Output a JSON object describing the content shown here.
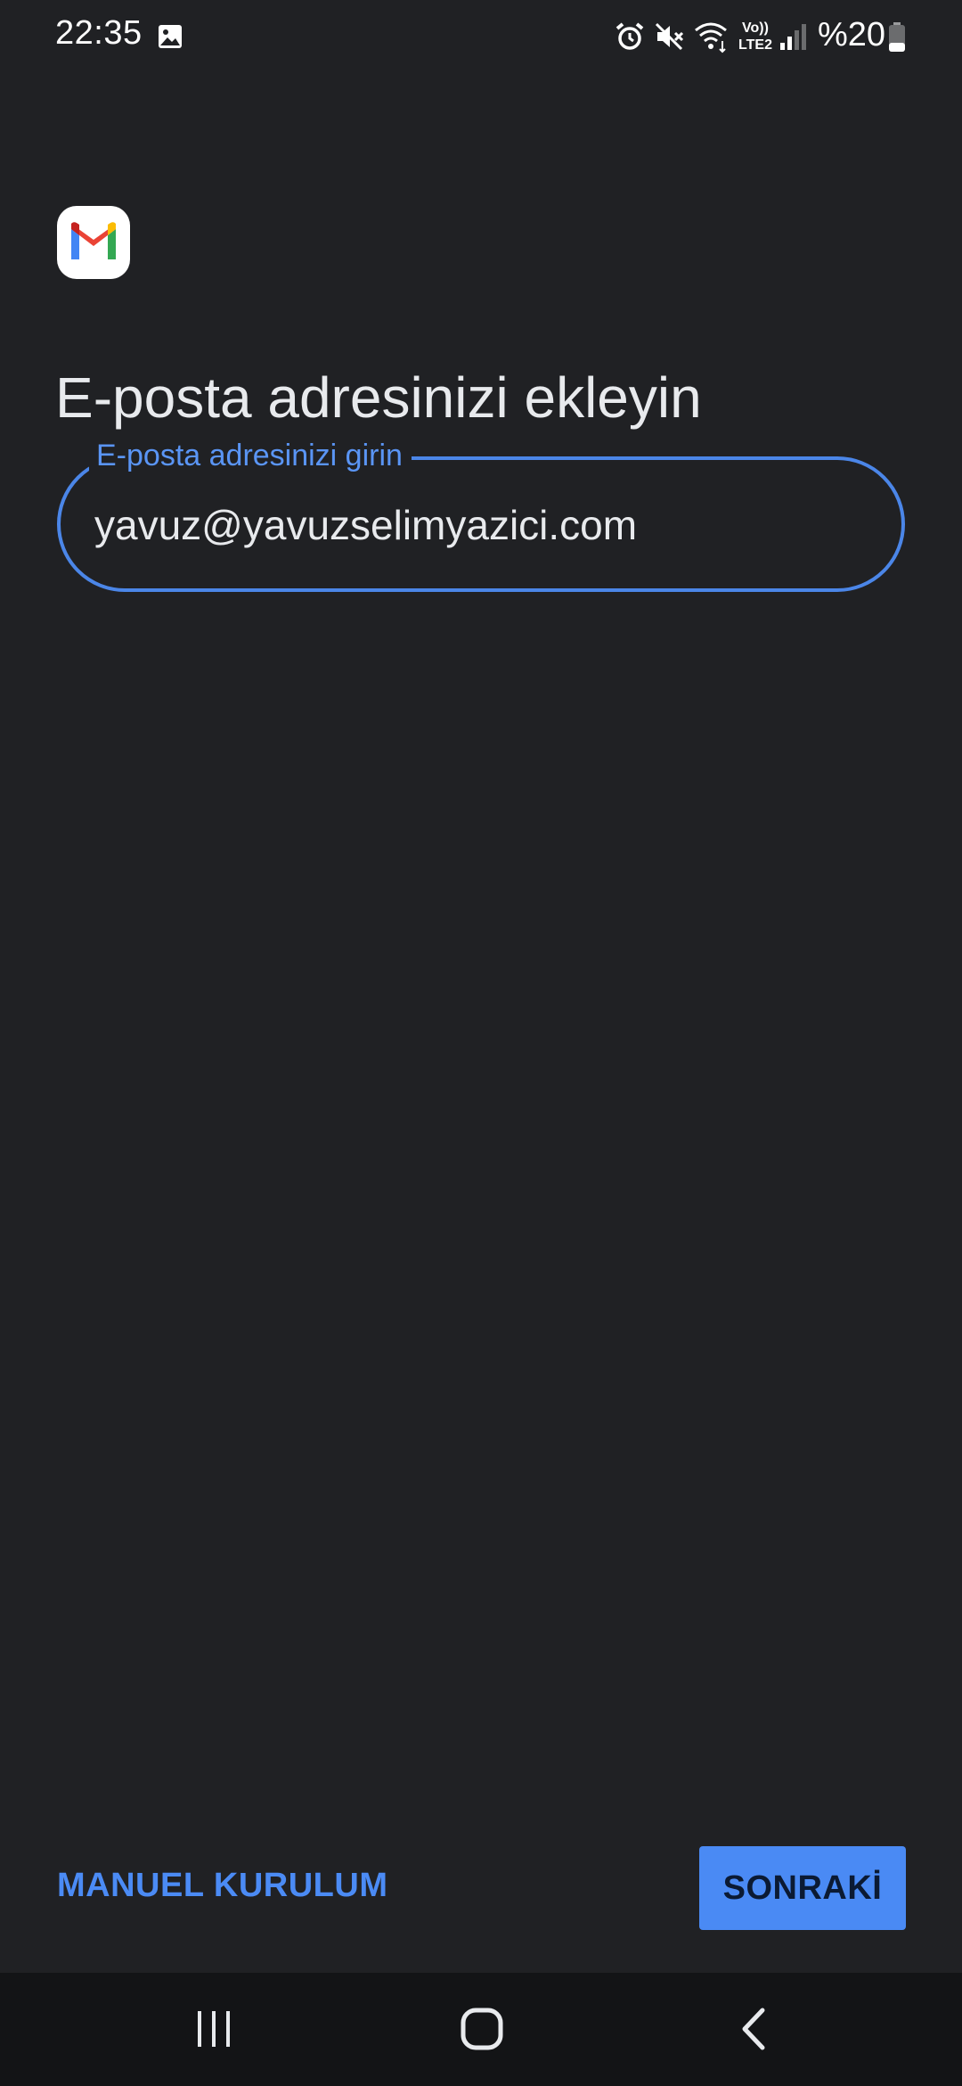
{
  "status_bar": {
    "time": "22:35",
    "battery": "%20",
    "network_label_top": "Vo))",
    "network_label_bottom": "LTE2",
    "icons": [
      "image-icon",
      "alarm-icon",
      "mute-icon",
      "wifi-icon",
      "signal-icon",
      "battery-icon"
    ]
  },
  "app": {
    "logo": "gmail-logo"
  },
  "page": {
    "title": "E-posta adresinizi ekleyin"
  },
  "email_field": {
    "label": "E-posta adresinizi girin",
    "value": "yavuz@yavuzselimyazici.com"
  },
  "actions": {
    "manual_setup_label": "MANUEL KURULUM",
    "next_label": "SONRAKİ"
  },
  "navigation": {
    "icons": [
      "recents-icon",
      "home-icon",
      "back-icon"
    ]
  },
  "colors": {
    "background": "#202124",
    "accent": "#4a8af4",
    "nav_bar": "#131416"
  }
}
